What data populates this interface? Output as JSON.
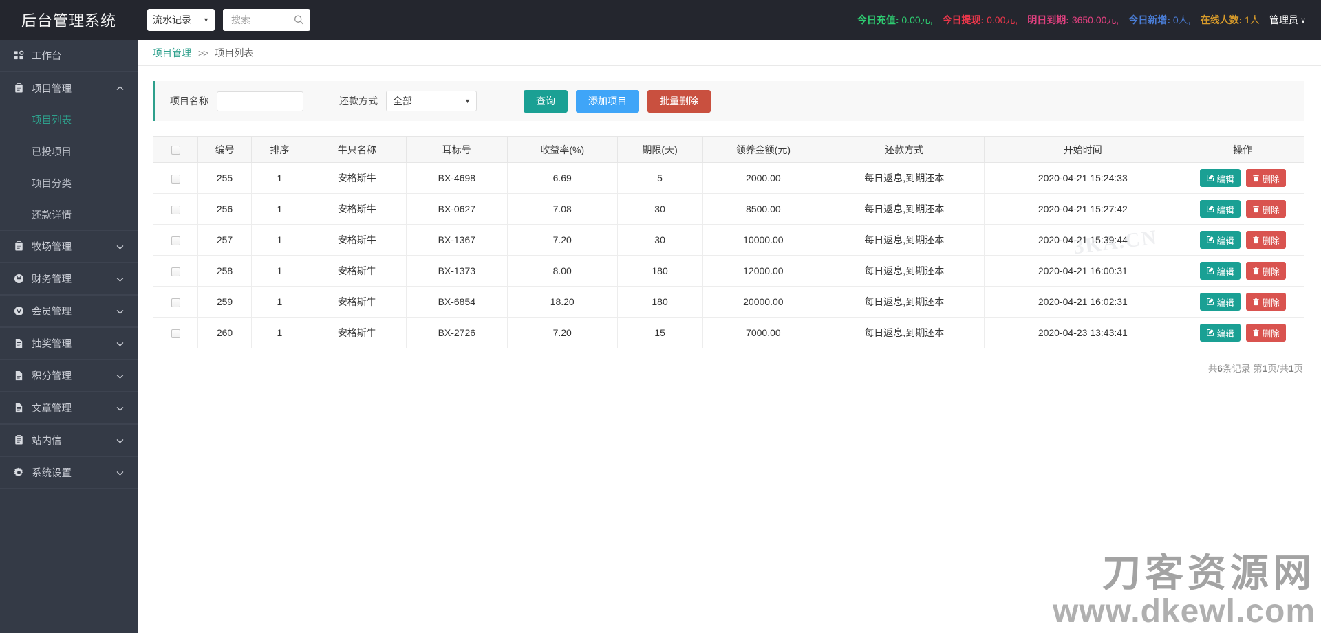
{
  "header": {
    "brand": "后台管理系统",
    "record_select": {
      "value": "流水记录",
      "caret": "▼"
    },
    "search": {
      "value": "",
      "placeholder": "搜索"
    },
    "stats": [
      {
        "label": "今日充值:",
        "value": "0.00元,",
        "color": "#2ecc71"
      },
      {
        "label": "今日提现:",
        "value": "0.00元,",
        "color": "#e8364a"
      },
      {
        "label": "明日到期:",
        "value": "3650.00元,",
        "color": "#e0407f"
      },
      {
        "label": "今日新增:",
        "value": "0人,",
        "color": "#4a7dd6"
      },
      {
        "label": "在线人数:",
        "value": "1人",
        "color": "#d89b2a"
      }
    ],
    "admin_label": "管理员",
    "admin_caret": "∨"
  },
  "sidebar": {
    "items": [
      {
        "label": "工作台",
        "icon": "dashboard-icon",
        "expandable": false
      },
      {
        "label": "项目管理",
        "icon": "clipboard-icon",
        "expandable": true,
        "expanded": true,
        "chevron": "up",
        "children": [
          {
            "label": "项目列表",
            "active": true
          },
          {
            "label": "已投项目",
            "active": false
          },
          {
            "label": "项目分类",
            "active": false
          },
          {
            "label": "还款详情",
            "active": false
          }
        ]
      },
      {
        "label": "牧场管理",
        "icon": "clipboard-icon",
        "expandable": true,
        "expanded": false,
        "chevron": "down"
      },
      {
        "label": "财务管理",
        "icon": "yen-icon",
        "expandable": true,
        "expanded": false,
        "chevron": "down"
      },
      {
        "label": "会员管理",
        "icon": "vip-icon",
        "expandable": true,
        "expanded": false,
        "chevron": "down"
      },
      {
        "label": "抽奖管理",
        "icon": "document-icon",
        "expandable": true,
        "expanded": false,
        "chevron": "down"
      },
      {
        "label": "积分管理",
        "icon": "document-icon",
        "expandable": true,
        "expanded": false,
        "chevron": "down"
      },
      {
        "label": "文章管理",
        "icon": "document-icon",
        "expandable": true,
        "expanded": false,
        "chevron": "down"
      },
      {
        "label": "站内信",
        "icon": "clipboard-icon",
        "expandable": true,
        "expanded": false,
        "chevron": "down"
      },
      {
        "label": "系统设置",
        "icon": "gear-icon",
        "expandable": true,
        "expanded": false,
        "chevron": "down"
      }
    ]
  },
  "breadcrumb": {
    "parent": "项目管理",
    "separator": ">>",
    "current": "项目列表"
  },
  "filter": {
    "name_label": "项目名称",
    "name_value": "",
    "repay_label": "还款方式",
    "repay_value": "全部",
    "repay_caret": "▼",
    "btn_query": "查询",
    "btn_add": "添加项目",
    "btn_batch_delete": "批量删除"
  },
  "table": {
    "columns": [
      "",
      "编号",
      "排序",
      "牛只名称",
      "耳标号",
      "收益率(%)",
      "期限(天)",
      "领养金额(元)",
      "还款方式",
      "开始时间",
      "操作"
    ],
    "rows": [
      {
        "id": "255",
        "sort": "1",
        "name": "安格斯牛",
        "tag": "BX-4698",
        "rate": "6.69",
        "term": "5",
        "amount": "2000.00",
        "repay": "每日返息,到期还本",
        "start": "2020-04-21 15:24:33"
      },
      {
        "id": "256",
        "sort": "1",
        "name": "安格斯牛",
        "tag": "BX-0627",
        "rate": "7.08",
        "term": "30",
        "amount": "8500.00",
        "repay": "每日返息,到期还本",
        "start": "2020-04-21 15:27:42"
      },
      {
        "id": "257",
        "sort": "1",
        "name": "安格斯牛",
        "tag": "BX-1367",
        "rate": "7.20",
        "term": "30",
        "amount": "10000.00",
        "repay": "每日返息,到期还本",
        "start": "2020-04-21 15:39:44"
      },
      {
        "id": "258",
        "sort": "1",
        "name": "安格斯牛",
        "tag": "BX-1373",
        "rate": "8.00",
        "term": "180",
        "amount": "12000.00",
        "repay": "每日返息,到期还本",
        "start": "2020-04-21 16:00:31"
      },
      {
        "id": "259",
        "sort": "1",
        "name": "安格斯牛",
        "tag": "BX-6854",
        "rate": "18.20",
        "term": "180",
        "amount": "20000.00",
        "repay": "每日返息,到期还本",
        "start": "2020-04-21 16:02:31"
      },
      {
        "id": "260",
        "sort": "1",
        "name": "安格斯牛",
        "tag": "BX-2726",
        "rate": "7.20",
        "term": "15",
        "amount": "7000.00",
        "repay": "每日返息,到期还本",
        "start": "2020-04-23 13:43:41"
      }
    ],
    "row_actions": {
      "edit": "编辑",
      "delete": "删除"
    }
  },
  "pagination": {
    "text": "共6条记录 第1页/共1页"
  },
  "watermarks": {
    "table": "3KA.CN",
    "brand_cn": "刀客资源网",
    "brand_url": "www.dkewl.com"
  },
  "colors": {
    "accent": "#2ea08c",
    "sidebar": "#343a46",
    "topbar": "#24262e",
    "blue": "#3fa5f8",
    "red": "#c9503f"
  }
}
